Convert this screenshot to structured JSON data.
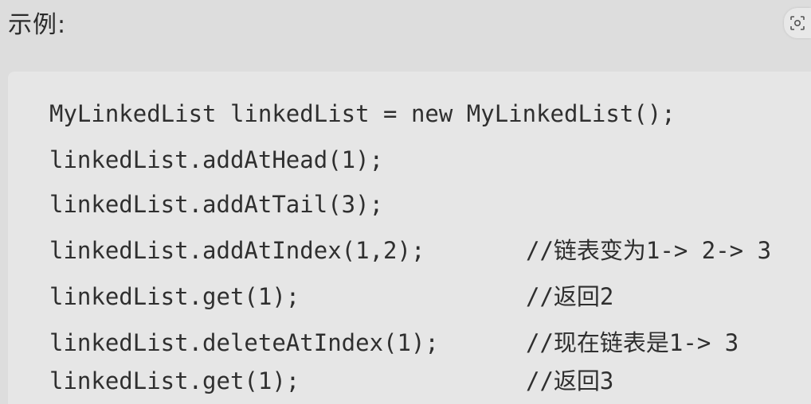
{
  "heading": "示例:",
  "icons": {
    "scan": "scan-icon"
  },
  "code_lines": [
    {
      "code": "MyLinkedList linkedList = new MyLinkedList();",
      "comment": ""
    },
    {
      "code": "linkedList.addAtHead(1);",
      "comment": ""
    },
    {
      "code": "linkedList.addAtTail(3);",
      "comment": ""
    },
    {
      "code": "linkedList.addAtIndex(1,2);",
      "comment": "//链表变为1-> 2-> 3"
    },
    {
      "code": "linkedList.get(1);",
      "comment": "//返回2"
    },
    {
      "code": "linkedList.deleteAtIndex(1);",
      "comment": "//现在链表是1-> 3"
    },
    {
      "code": "linkedList.get(1);",
      "comment": "//返回3"
    }
  ]
}
